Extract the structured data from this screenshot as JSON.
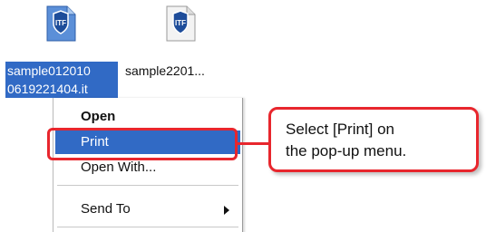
{
  "desktop": {
    "files": [
      {
        "label_line1": "sample012010",
        "label_line2": "0619221404.it",
        "icon": "itf-file-icon",
        "icon_text": "ITF"
      },
      {
        "label": "sample2201...",
        "icon": "itf-file-icon",
        "icon_text": "ITF"
      }
    ]
  },
  "context_menu": {
    "items": [
      {
        "label": "Open"
      },
      {
        "label": "Print"
      },
      {
        "label": "Open With..."
      },
      {
        "label": "Send To"
      }
    ]
  },
  "callout": {
    "line1": "Select [Print] on",
    "line2": "the pop-up menu."
  },
  "colors": {
    "selection": "#316ac5",
    "highlight": "#e8262d"
  }
}
